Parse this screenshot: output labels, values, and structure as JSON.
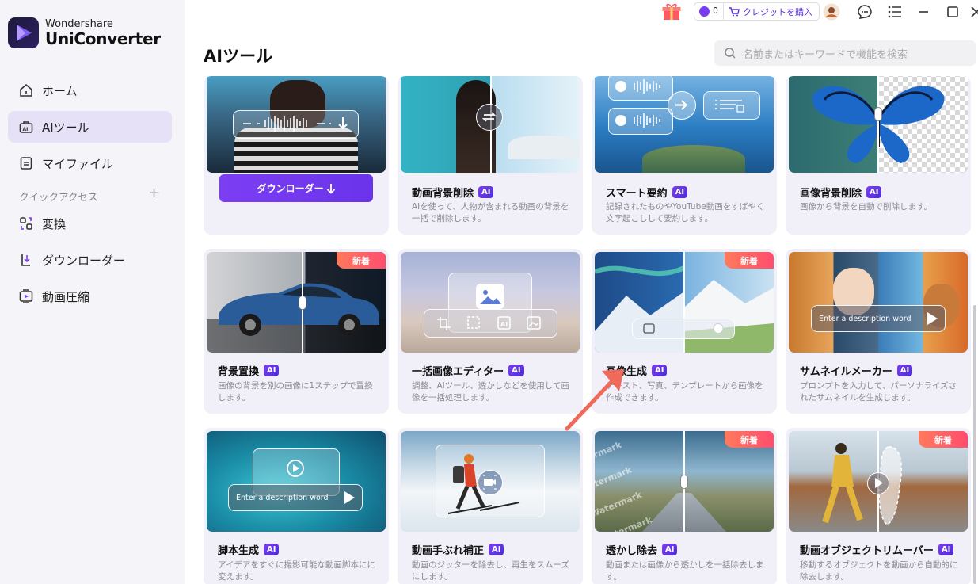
{
  "app": {
    "brand_sub": "Wondershare",
    "brand_main": "UniConverter"
  },
  "sidebar": {
    "items": [
      {
        "label": "ホーム"
      },
      {
        "label": "AIツール"
      },
      {
        "label": "マイファイル"
      }
    ],
    "quick_access_label": "クイックアクセス",
    "quick_items": [
      {
        "label": "変換"
      },
      {
        "label": "ダウンローダー"
      },
      {
        "label": "動画圧縮"
      }
    ]
  },
  "topbar": {
    "credits": "0",
    "buy_label": "クレジットを購入"
  },
  "main": {
    "title": "AIツール",
    "search_placeholder": "名前またはキーワードで機能を検索"
  },
  "cards": {
    "downloader": {
      "button": "ダウンローダー"
    },
    "bg_remove_video": {
      "title": "動画背景削除",
      "desc": "AIを使って、人物が含まれる動画の背景を一括で削除します。"
    },
    "smart_summary": {
      "title": "スマート要約",
      "desc": "記録されたものやYouTube動画をすばやく文字起こしして要約します。"
    },
    "bg_remove_image": {
      "title": "画像背景削除",
      "desc": "画像から背景を自動で削除します。"
    },
    "bg_replace": {
      "title": "背景置換",
      "badge": "新着",
      "desc": "画像の背景を別の画像に1ステップで置換します。"
    },
    "batch_editor": {
      "title": "一括画像エディター",
      "desc": "調整、AIツール、透かしなどを使用して画像を一括処理します。"
    },
    "image_gen": {
      "title": "画像生成",
      "badge": "新着",
      "desc": "テキスト、写真、テンプレートから画像を作成できます。"
    },
    "thumbnail": {
      "title": "サムネイルメーカー",
      "desc": "プロンプトを入力して、パーソナライズされたサムネイルを生成します。",
      "enter": "Enter a description word"
    },
    "script_gen": {
      "title": "脚本生成",
      "desc": "アイデアをすぐに撮影可能な動画脚本にに変えます。",
      "enter": "Enter a description word"
    },
    "stabilize": {
      "title": "動画手ぶれ補正",
      "desc": "動画のジッターを除去し、再生をスムーズにします。"
    },
    "watermark": {
      "title": "透かし除去",
      "badge": "新着",
      "desc": "動画または画像から透かしを一括除去します。",
      "wm_text": "Watermark"
    },
    "object_remove": {
      "title": "動画オブジェクトリムーバー",
      "badge": "新着",
      "desc": "移動するオブジェクトを動画から自動的に除去します。"
    },
    "ai_label": "AI"
  },
  "colors": {
    "accent": "#6a34ea",
    "new_badge": "#ff5a63",
    "sidebar_active": "#e6e1f6"
  }
}
